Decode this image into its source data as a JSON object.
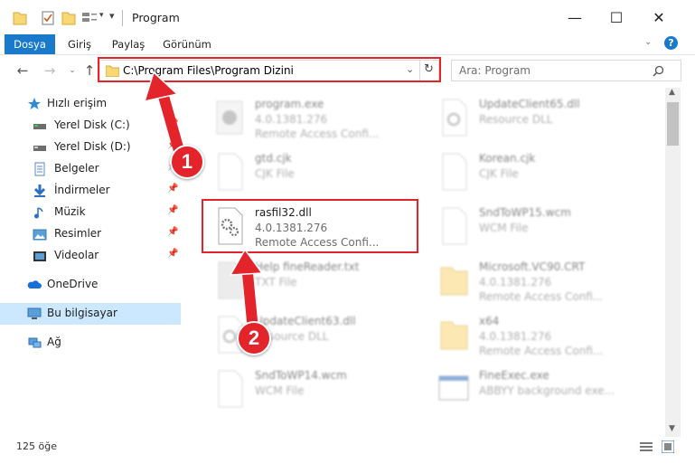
{
  "window": {
    "title": "Program"
  },
  "ribbon": {
    "tabs": [
      "Dosya",
      "Giriş",
      "Paylaş",
      "Görünüm"
    ]
  },
  "address": {
    "path": "C:\\Program Files\\Program Dizini"
  },
  "search": {
    "placeholder": "Ara: Program"
  },
  "sidebar": {
    "items": [
      {
        "label": "Hızlı erişim",
        "icon": "star-icon"
      },
      {
        "label": "Yerel Disk (C:)",
        "icon": "drive-icon"
      },
      {
        "label": "Yerel Disk (D:)",
        "icon": "drive-icon"
      },
      {
        "label": "Belgeler",
        "icon": "documents-icon"
      },
      {
        "label": "İndirmeler",
        "icon": "download-icon"
      },
      {
        "label": "Müzik",
        "icon": "music-icon"
      },
      {
        "label": "Resimler",
        "icon": "pictures-icon"
      },
      {
        "label": "Videolar",
        "icon": "videos-icon"
      },
      {
        "label": "OneDrive",
        "icon": "cloud-icon"
      },
      {
        "label": "Bu bilgisayar",
        "icon": "computer-icon"
      },
      {
        "label": "Ağ",
        "icon": "network-icon"
      }
    ]
  },
  "files": [
    {
      "name": "program.exe",
      "line1": "4.0.1381.276",
      "line2": "Remote Access Confi..."
    },
    {
      "name": "UpdateClient65.dll",
      "line1": "Resource DLL",
      "line2": ""
    },
    {
      "name": "gtd.cjk",
      "line1": "CJK File",
      "line2": ""
    },
    {
      "name": "Korean.cjk",
      "line1": "CJK File",
      "line2": ""
    },
    {
      "name": "rasfil32.dll",
      "line1": "4.0.1381.276",
      "line2": "Remote Access Confi..."
    },
    {
      "name": "SndToWP15.wcm",
      "line1": "WCM File",
      "line2": ""
    },
    {
      "name": "Help fineReader.txt",
      "line1": "TXT File",
      "line2": ""
    },
    {
      "name": "Microsoft.VC90.CRT",
      "line1": "4.0.1381.276",
      "line2": "Remote Access Confi..."
    },
    {
      "name": "UpdateClient63.dll",
      "line1": "Resource DLL",
      "line2": ""
    },
    {
      "name": "x64",
      "line1": "4.0.1381.276",
      "line2": "Remote Access Confi..."
    },
    {
      "name": "SndToWP14.wcm",
      "line1": "WCM File",
      "line2": ""
    },
    {
      "name": "FineExec.exe",
      "line1": "ABBYY background exe...",
      "line2": ""
    }
  ],
  "status": {
    "count": "125 öğe"
  },
  "annotations": [
    "1",
    "2"
  ],
  "colors": {
    "accent": "#1979ca",
    "highlight": "#e3242b",
    "selected": "#cce8ff"
  }
}
